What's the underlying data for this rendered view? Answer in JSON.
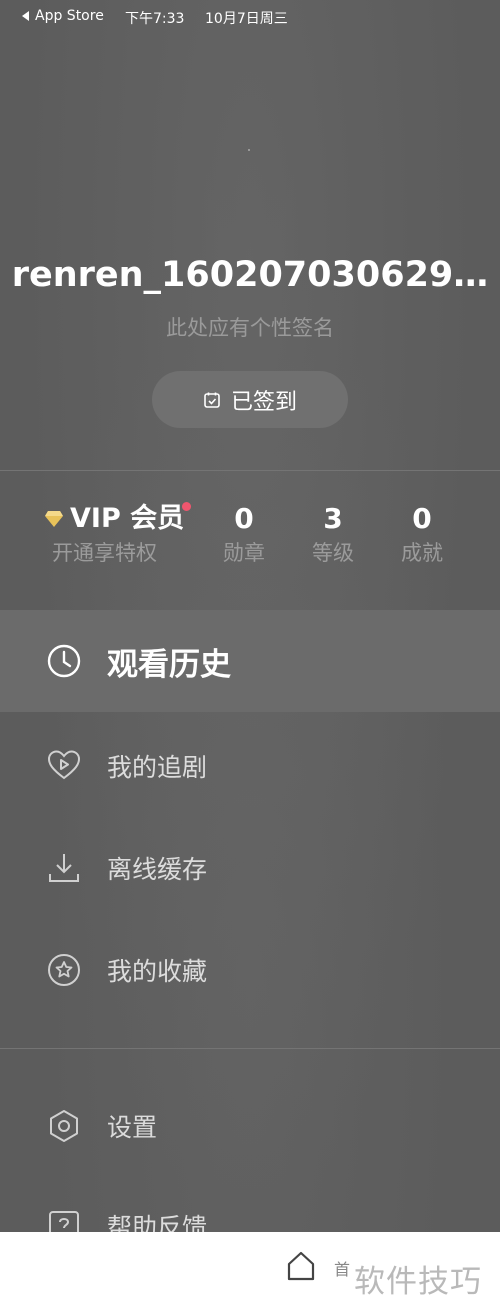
{
  "status_bar": {
    "back_app": "App Store",
    "time": "下午7:33",
    "date": "10月7日周三"
  },
  "profile": {
    "username": "renren_160207030629…",
    "signature": "此处应有个性签名",
    "checkin_label": "已签到"
  },
  "stats": {
    "vip": {
      "title": "VIP 会员",
      "subtitle": "开通享特权"
    },
    "items": [
      {
        "value": "0",
        "label": "勋章"
      },
      {
        "value": "3",
        "label": "等级"
      },
      {
        "value": "0",
        "label": "成就"
      }
    ]
  },
  "menu": [
    {
      "label": "观看历史",
      "icon": "clock-icon"
    },
    {
      "label": "我的追剧",
      "icon": "heart-play-icon"
    },
    {
      "label": "离线缓存",
      "icon": "download-icon"
    },
    {
      "label": "我的收藏",
      "icon": "star-circle-icon"
    },
    {
      "label": "设置",
      "icon": "hexagon-settings-icon"
    },
    {
      "label": "帮助反馈",
      "icon": "help-feedback-icon"
    }
  ],
  "tabbar": {
    "home_label": "首"
  },
  "watermark": "软件技巧",
  "colors": {
    "background": "#5c5c5c",
    "highlight": "#6b6b6b",
    "badge_dot": "#f0566e",
    "vip_gold": "#e8c25a"
  }
}
